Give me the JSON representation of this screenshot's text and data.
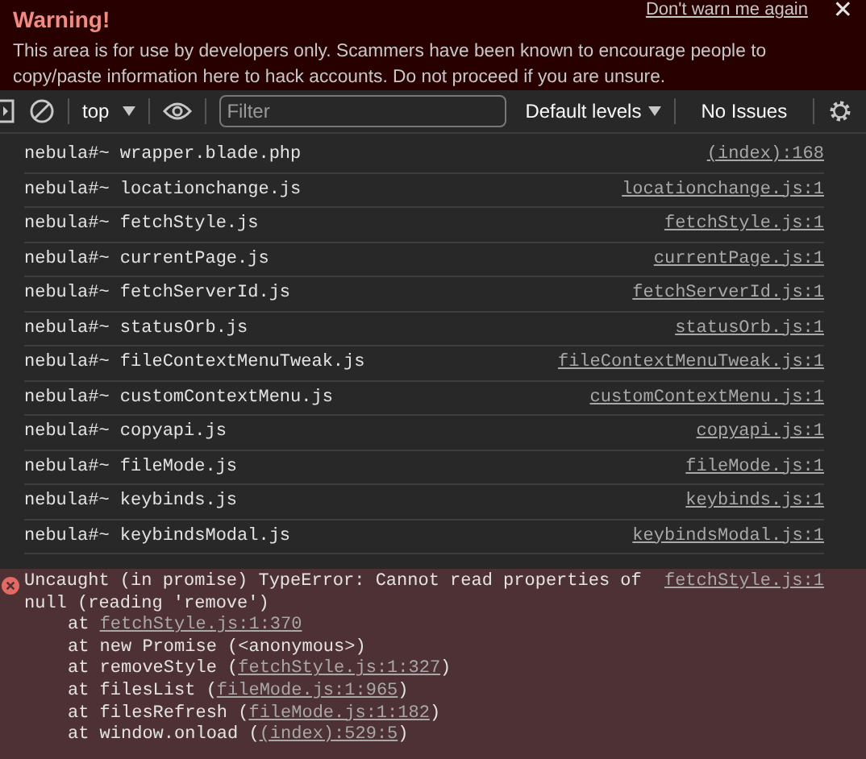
{
  "warning": {
    "title": "Warning!",
    "dismiss": "Don't warn me again",
    "close": "✕",
    "message": "This area is for use by developers only. Scammers have been known to encourage people to copy/paste information here to hack accounts. Do not proceed if you are unsure."
  },
  "toolbar": {
    "context": "top",
    "filter": {
      "placeholder": "Filter"
    },
    "levels": "Default levels",
    "issues": "No Issues"
  },
  "logs": [
    {
      "prompt": "nebula#~",
      "text": "wrapper.blade.php",
      "source": "(index):168"
    },
    {
      "prompt": "nebula#~",
      "text": "locationchange.js",
      "source": "locationchange.js:1"
    },
    {
      "prompt": "nebula#~",
      "text": "fetchStyle.js",
      "source": "fetchStyle.js:1"
    },
    {
      "prompt": "nebula#~",
      "text": "currentPage.js",
      "source": "currentPage.js:1"
    },
    {
      "prompt": "nebula#~",
      "text": "fetchServerId.js",
      "source": "fetchServerId.js:1"
    },
    {
      "prompt": "nebula#~",
      "text": "statusOrb.js",
      "source": "statusOrb.js:1"
    },
    {
      "prompt": "nebula#~",
      "text": "fileContextMenuTweak.js",
      "source": "fileContextMenuTweak.js:1"
    },
    {
      "prompt": "nebula#~",
      "text": "customContextMenu.js",
      "source": "customContextMenu.js:1"
    },
    {
      "prompt": "nebula#~",
      "text": "copyapi.js",
      "source": "copyapi.js:1"
    },
    {
      "prompt": "nebula#~",
      "text": "fileMode.js",
      "source": "fileMode.js:1"
    },
    {
      "prompt": "nebula#~",
      "text": "keybinds.js",
      "source": "keybinds.js:1"
    },
    {
      "prompt": "nebula#~",
      "text": "keybindsModal.js",
      "source": "keybindsModal.js:1"
    }
  ],
  "error": {
    "message": "Uncaught (in promise) TypeError: Cannot read properties of null (reading 'remove')",
    "source": "fetchStyle.js:1",
    "frames": [
      {
        "prefix": "at ",
        "link": "fetchStyle.js:1:370"
      },
      {
        "prefix": "at new Promise (<anonymous>)"
      },
      {
        "prefix": "at removeStyle (",
        "link": "fetchStyle.js:1:327",
        "suffix": ")"
      },
      {
        "prefix": "at filesList (",
        "link": "fileMode.js:1:965",
        "suffix": ")"
      },
      {
        "prefix": "at filesRefresh (",
        "link": "fileMode.js:1:182",
        "suffix": ")"
      },
      {
        "prefix": "at window.onload (",
        "link": "(index):529:5",
        "suffix": ")"
      }
    ]
  }
}
